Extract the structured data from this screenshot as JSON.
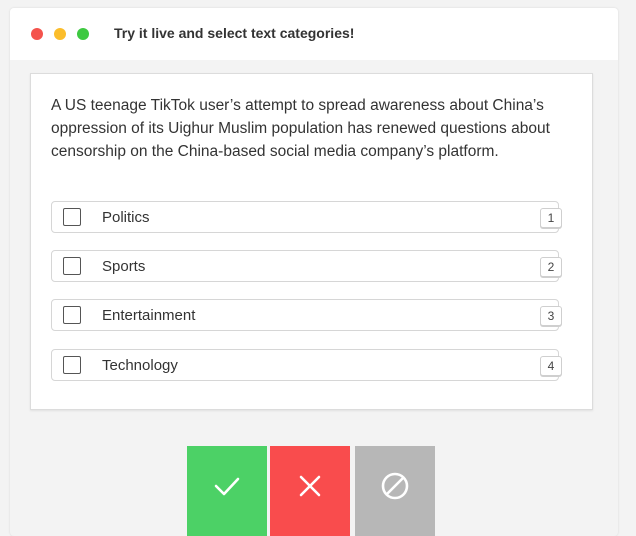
{
  "window": {
    "title": "Try it live and select text categories!",
    "controls": [
      "close",
      "minimize",
      "maximize"
    ]
  },
  "card": {
    "text": "A US teenage TikTok user’s attempt to spread awareness about China’s oppression of its Uighur Muslim population has renewed questions about censorship on the China-based social media company’s platform.",
    "options": [
      {
        "label": "Politics",
        "hotkey": "1",
        "checked": false
      },
      {
        "label": "Sports",
        "hotkey": "2",
        "checked": false
      },
      {
        "label": "Entertainment",
        "hotkey": "3",
        "checked": false
      },
      {
        "label": "Technology",
        "hotkey": "4",
        "checked": false
      }
    ]
  },
  "actions": {
    "accept": {
      "icon": "check-icon",
      "color": "#4cd166"
    },
    "reject": {
      "icon": "close-icon",
      "color": "#f94c4d"
    },
    "ignore": {
      "icon": "ban-icon",
      "color": "#b7b7b7"
    }
  }
}
